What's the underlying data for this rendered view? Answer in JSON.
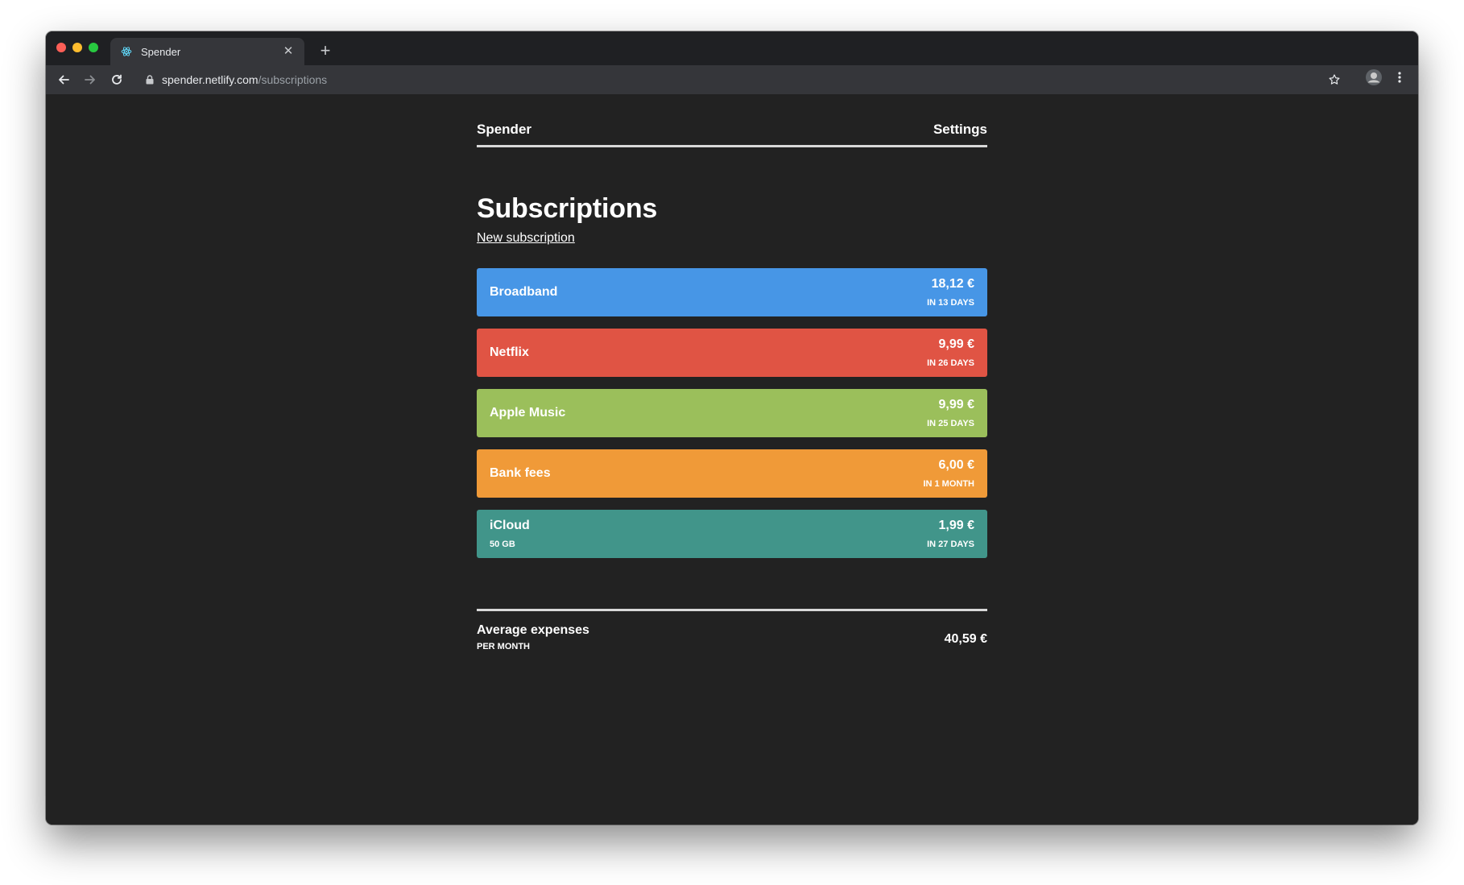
{
  "browser": {
    "tab": {
      "title": "Spender",
      "favicon": "react-atom-icon"
    },
    "url": {
      "host": "spender.netlify.com",
      "path": "/subscriptions"
    }
  },
  "nav": {
    "brand": "Spender",
    "settings": "Settings"
  },
  "page": {
    "title": "Subscriptions",
    "new_link": "New subscription"
  },
  "subscriptions": [
    {
      "name": "Broadband",
      "detail": "",
      "price": "18,12 €",
      "due": "IN 13 DAYS",
      "color": "#4796e6"
    },
    {
      "name": "Netflix",
      "detail": "",
      "price": "9,99 €",
      "due": "IN 26 DAYS",
      "color": "#e05444"
    },
    {
      "name": "Apple Music",
      "detail": "",
      "price": "9,99 €",
      "due": "IN 25 DAYS",
      "color": "#9bbf5b"
    },
    {
      "name": "Bank fees",
      "detail": "",
      "price": "6,00 €",
      "due": "IN 1 MONTH",
      "color": "#f09a38"
    },
    {
      "name": "iCloud",
      "detail": "50 GB",
      "price": "1,99 €",
      "due": "IN 27 DAYS",
      "color": "#41958a"
    }
  ],
  "summary": {
    "label": "Average expenses",
    "sublabel": "PER MONTH",
    "value": "40,59 €"
  }
}
